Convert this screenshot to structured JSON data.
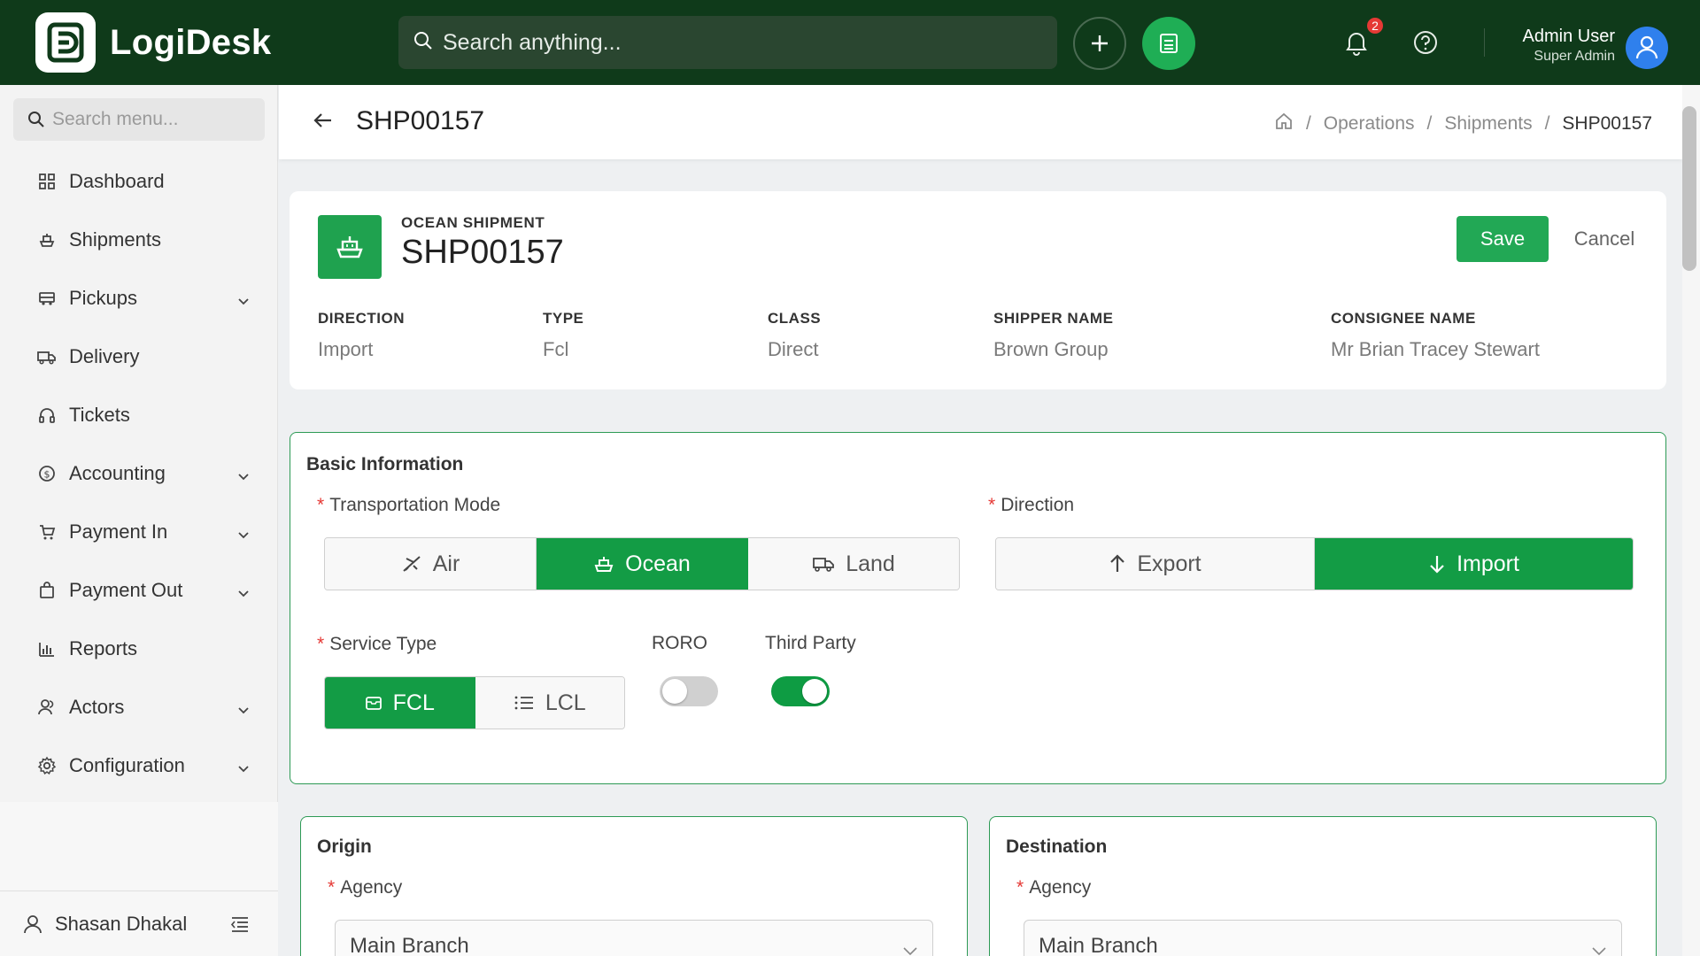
{
  "app": {
    "name": "LogiDesk"
  },
  "topbar": {
    "search_placeholder": "Search anything...",
    "notification_count": "2",
    "user_name": "Admin User",
    "user_role": "Super Admin"
  },
  "sidebar": {
    "search_placeholder": "Search menu...",
    "items": [
      {
        "label": "Dashboard",
        "icon": "grid-icon",
        "expandable": false
      },
      {
        "label": "Shipments",
        "icon": "ship-icon",
        "expandable": false
      },
      {
        "label": "Pickups",
        "icon": "truck-icon",
        "expandable": true
      },
      {
        "label": "Delivery",
        "icon": "delivery-truck-icon",
        "expandable": false
      },
      {
        "label": "Tickets",
        "icon": "headset-icon",
        "expandable": false
      },
      {
        "label": "Accounting",
        "icon": "dollar-circle-icon",
        "expandable": true
      },
      {
        "label": "Payment In",
        "icon": "cart-icon",
        "expandable": true
      },
      {
        "label": "Payment Out",
        "icon": "bag-icon",
        "expandable": true
      },
      {
        "label": "Reports",
        "icon": "bar-chart-icon",
        "expandable": false
      },
      {
        "label": "Actors",
        "icon": "users-icon",
        "expandable": true
      },
      {
        "label": "Configuration",
        "icon": "gear-icon",
        "expandable": true
      }
    ],
    "footer_user": "Shasan Dhakal"
  },
  "page_header": {
    "title": "SHP00157",
    "breadcrumb": [
      "Operations",
      "Shipments",
      "SHP00157"
    ]
  },
  "summary": {
    "kind": "OCEAN SHIPMENT",
    "id": "SHP00157",
    "save_label": "Save",
    "cancel_label": "Cancel",
    "fields": [
      {
        "label": "DIRECTION",
        "value": "Import"
      },
      {
        "label": "TYPE",
        "value": "Fcl"
      },
      {
        "label": "CLASS",
        "value": "Direct"
      },
      {
        "label": "SHIPPER NAME",
        "value": "Brown Group"
      },
      {
        "label": "CONSIGNEE NAME",
        "value": "Mr Brian Tracey Stewart"
      }
    ]
  },
  "basic_info": {
    "title": "Basic Information",
    "transportation_mode": {
      "label": "Transportation Mode",
      "options": [
        "Air",
        "Ocean",
        "Land"
      ],
      "selected": "Ocean"
    },
    "direction": {
      "label": "Direction",
      "options": [
        "Export",
        "Import"
      ],
      "selected": "Import"
    },
    "service_type": {
      "label": "Service Type",
      "options": [
        "FCL",
        "LCL"
      ],
      "selected": "FCL"
    },
    "roro": {
      "label": "RORO",
      "enabled": false
    },
    "third_party": {
      "label": "Third Party",
      "enabled": true
    }
  },
  "origin": {
    "title": "Origin",
    "agency_label": "Agency",
    "agency_value": "Main Branch"
  },
  "destination": {
    "title": "Destination",
    "agency_label": "Agency",
    "agency_value": "Main Branch"
  },
  "colors": {
    "brand_dark": "#0f3a1a",
    "accent": "#139c45",
    "danger": "#e53935"
  }
}
